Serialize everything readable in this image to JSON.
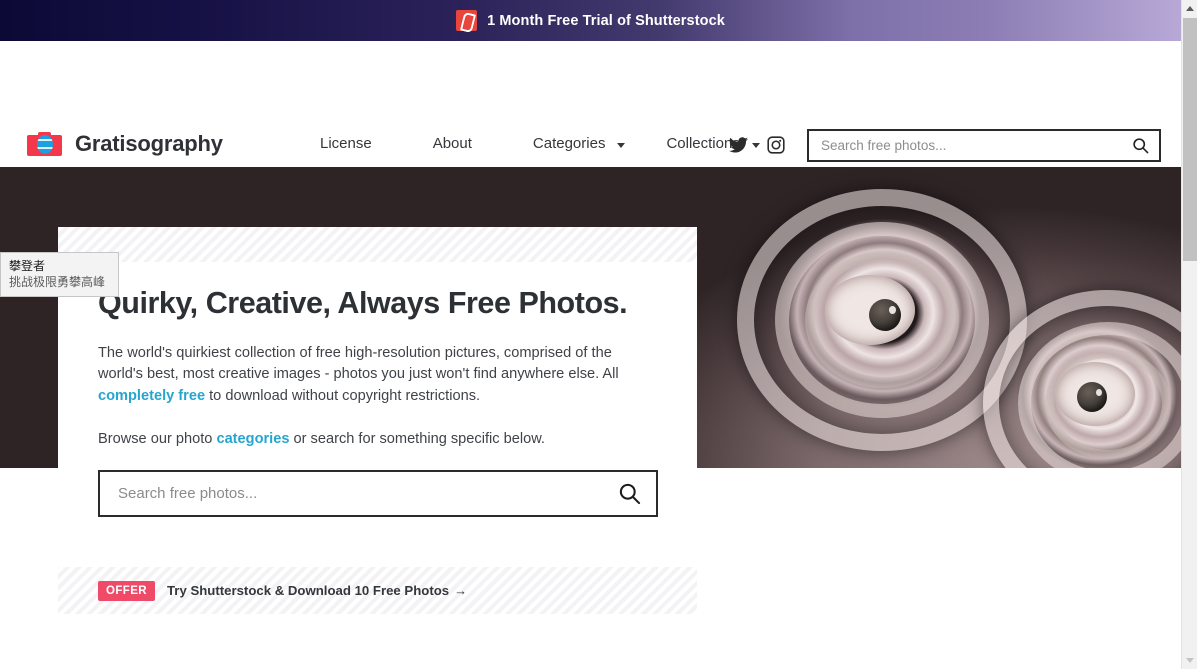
{
  "promo_banner": {
    "text": "1 Month Free Trial of Shutterstock",
    "icon": "shutterstock-logo-icon",
    "gradient_from": "#0c0936",
    "gradient_to": "#b7a8d6"
  },
  "header": {
    "brand": {
      "name": "Gratisography",
      "icon": "camera-logo-icon",
      "body_color": "#f4374a",
      "lens_color": "#1ba0e2"
    },
    "nav": [
      {
        "label": "License",
        "has_dropdown": false
      },
      {
        "label": "About",
        "has_dropdown": false
      },
      {
        "label": "Categories",
        "has_dropdown": true
      },
      {
        "label": "Collections",
        "has_dropdown": true
      }
    ],
    "social": [
      {
        "name": "twitter-icon",
        "label": "Twitter"
      },
      {
        "name": "instagram-icon",
        "label": "Instagram"
      }
    ],
    "search": {
      "placeholder": "Search free photos...",
      "value": "",
      "icon": "search-icon"
    }
  },
  "hero": {
    "title": "Quirky, Creative, Always Free Photos.",
    "paragraph1_part1": "The world's quirkiest collection of free high-resolution pictures, comprised of the world's best, most creative images - photos you just won't find anywhere else. All ",
    "paragraph1_link": "completely free",
    "paragraph1_part2": " to download without copyright restrictions.",
    "paragraph2_part1": "Browse our photo ",
    "paragraph2_link": "categories",
    "paragraph2_part2": " or search for something specific below.",
    "link_color": "#26a6cf",
    "search": {
      "placeholder": "Search free photos...",
      "value": "",
      "icon": "search-icon"
    },
    "image_alt": "Two eyes peering through metal can rings"
  },
  "offer": {
    "badge": "OFFER",
    "badge_color": "#ef4a68",
    "text": "Try Shutterstock & Download 10 Free Photos",
    "arrow": "→"
  },
  "tooltip": {
    "title": "攀登者",
    "subtitle": "挑战极限勇攀高峰"
  },
  "scrollbar": {
    "up_arrow": "▲",
    "down_arrow": "▼"
  }
}
